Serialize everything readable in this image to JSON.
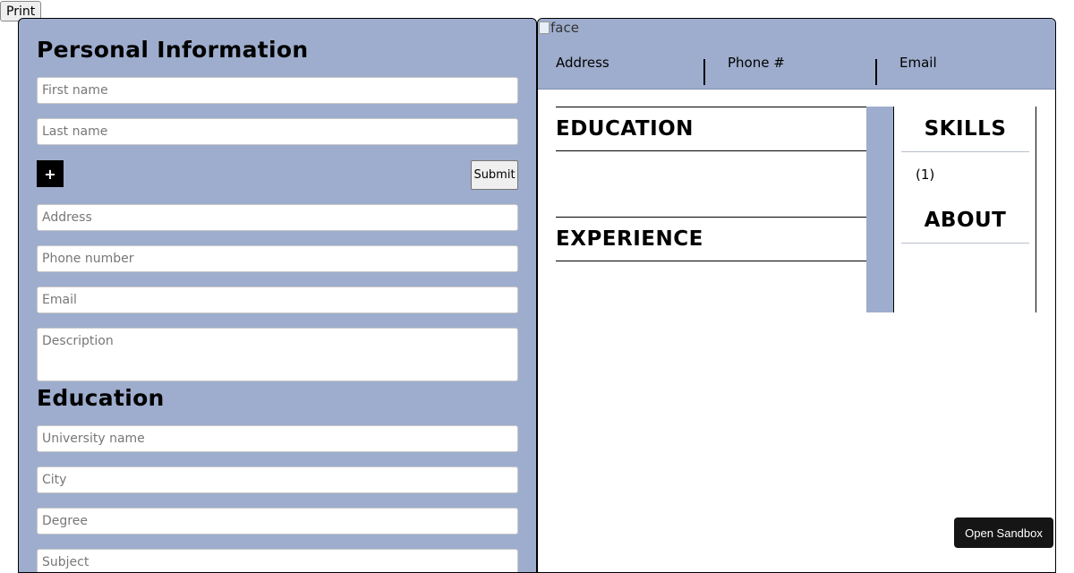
{
  "toolbar": {
    "print_label": "Print"
  },
  "form": {
    "personal_title": "Personal Information",
    "first_name_placeholder": "First name",
    "last_name_placeholder": "Last name",
    "add_label": "+",
    "submit_label": "Submit",
    "address_placeholder": "Address",
    "phone_placeholder": "Phone number",
    "email_placeholder": "Email",
    "description_placeholder": "Description",
    "education_title": "Education",
    "university_placeholder": "University name",
    "city_placeholder": "City",
    "degree_placeholder": "Degree",
    "subject_placeholder": "Subject"
  },
  "cv": {
    "photo_alt": "face",
    "address_label": "Address",
    "phone_label": "Phone #",
    "email_label": "Email",
    "education_heading": "EDUCATION",
    "experience_heading": "EXPERIENCE",
    "skills_heading": "SKILLS",
    "skill_item": "(1)",
    "about_heading": "ABOUT"
  },
  "sandbox": {
    "label": "Open Sandbox"
  },
  "colors": {
    "panel": "#9eadcd",
    "sandbox_bg": "#151515"
  }
}
